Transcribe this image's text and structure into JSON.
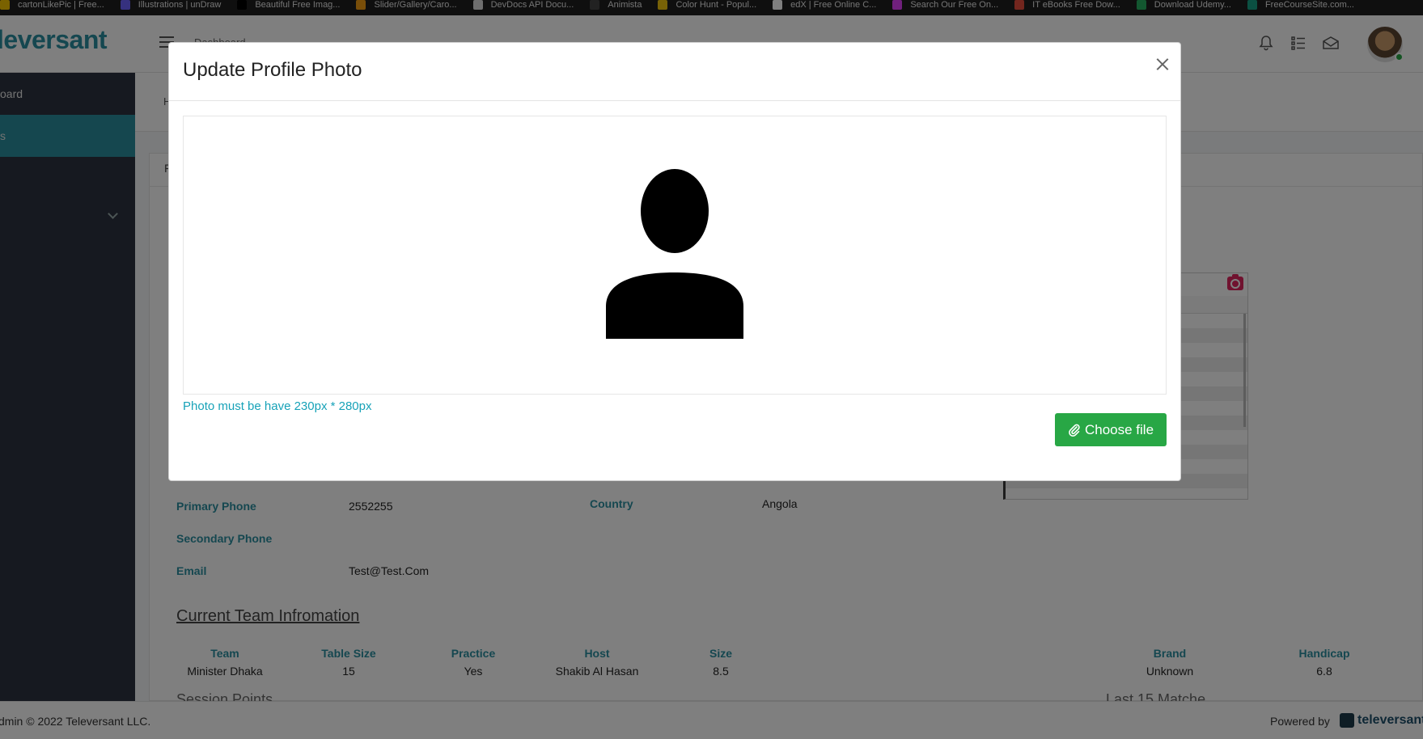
{
  "bookmarks": [
    {
      "label": "cartonLikePic | Free...",
      "icon": "cartoon-icon",
      "color": "#f5c400"
    },
    {
      "label": "Illustrations | unDraw",
      "icon": "undraw-icon",
      "color": "#6c63ff"
    },
    {
      "label": "Beautiful Free Imag...",
      "icon": "unsplash-icon",
      "color": "#000000"
    },
    {
      "label": "Slider/Gallery/Caro...",
      "icon": "slider-icon",
      "color": "#f39c12"
    },
    {
      "label": "DevDocs API Docu...",
      "icon": "devdocs-icon",
      "color": "#dddddd"
    },
    {
      "label": "Animista",
      "icon": "animista-icon",
      "color": "#444444"
    },
    {
      "label": "Color Hunt - Popul...",
      "icon": "colorhunt-icon",
      "color": "#f1c40f"
    },
    {
      "label": "edX | Free Online C...",
      "icon": "edx-icon",
      "color": "#ffffff"
    },
    {
      "label": "Search Our Free On...",
      "icon": "search-courses-icon",
      "color": "#e040fb"
    },
    {
      "label": "IT eBooks Free Dow...",
      "icon": "ebooks-icon",
      "color": "#e74c3c"
    },
    {
      "label": "Download Udemy...",
      "icon": "udemy-icon",
      "color": "#27ae60"
    },
    {
      "label": "FreeCourseSite.com...",
      "icon": "freecourse-icon",
      "color": "#16a085"
    }
  ],
  "header": {
    "brand": "leversant",
    "breadcrumb_top": "Dashboard"
  },
  "sidebar": {
    "items": [
      {
        "label": "oard"
      },
      {
        "label": "s"
      }
    ]
  },
  "content": {
    "breadcrumb": "H",
    "tab": "F",
    "fields": {
      "primary_phone_label": "Primary Phone",
      "primary_phone_value": "2552255",
      "secondary_phone_label": "Secondary Phone",
      "email_label": "Email",
      "email_value": "Test@Test.Com",
      "country_label": "Country",
      "country_value": "Angola"
    },
    "team_section_title": "Current Team Infromation",
    "team_table": {
      "headers": [
        "Team",
        "Table Size",
        "Practice",
        "Host",
        "Size",
        "Brand",
        "Handicap"
      ],
      "row": [
        "Minister Dhaka",
        "15",
        "Yes",
        "Shakib Al Hasan",
        "8.5",
        "Unknown",
        "6.8"
      ]
    },
    "next_sections": [
      "Session Points",
      "Last 15 Matche"
    ]
  },
  "footer": {
    "copyright": "dmin © 2022 Televersant LLC.",
    "powered_by": "Powered by",
    "powered_name": "televersant"
  },
  "modal": {
    "title": "Update Profile Photo",
    "hint": "Photo must be have 230px * 280px",
    "choose_button": "Choose file"
  },
  "colors": {
    "accent": "#2b8fa0",
    "sidebar": "#2c3340",
    "button_green": "#28a745",
    "hint": "#17a2b8"
  }
}
